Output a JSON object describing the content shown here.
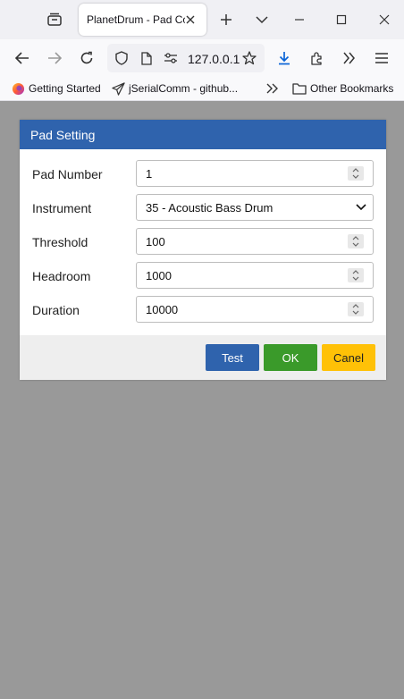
{
  "browser": {
    "tab_title": "PlanetDrum - Pad Co",
    "url": "127.0.0.1",
    "bookmarks": [
      {
        "label": "Getting Started"
      },
      {
        "label": "jSerialComm - github..."
      }
    ],
    "other_bookmarks": "Other Bookmarks",
    "icons": {
      "tab_list": "tab-list-icon",
      "new_tab": "plus-icon",
      "tabs_menu": "chevron-down-icon",
      "minimize": "minimize-icon",
      "maximize": "maximize-icon",
      "close": "close-icon",
      "back": "back-arrow-icon",
      "forward": "forward-arrow-icon",
      "reload": "reload-icon",
      "shield": "shield-icon",
      "page": "page-icon",
      "permissions": "permissions-icon",
      "star": "star-icon",
      "download": "download-icon",
      "extensions": "extensions-icon",
      "overflow": "double-chevron-icon",
      "menu": "hamburger-icon",
      "folder": "folder-icon"
    }
  },
  "dialog": {
    "title": "Pad Setting",
    "fields": [
      {
        "label": "Pad Number",
        "value": "1",
        "type": "number"
      },
      {
        "label": "Instrument",
        "value": "35 - Acoustic Bass Drum",
        "type": "select"
      },
      {
        "label": "Threshold",
        "value": "100",
        "type": "number"
      },
      {
        "label": "Headroom",
        "value": "1000",
        "type": "number"
      },
      {
        "label": "Duration",
        "value": "10000",
        "type": "number"
      }
    ],
    "buttons": {
      "test": "Test",
      "ok": "OK",
      "cancel": "Canel"
    }
  },
  "colors": {
    "header_blue": "#2f63ad",
    "test_button": "#2f63ad",
    "ok_button": "#3a9a2a",
    "cancel_button": "#ffc107",
    "page_background": "#999999",
    "download_icon": "#0a64d6"
  }
}
